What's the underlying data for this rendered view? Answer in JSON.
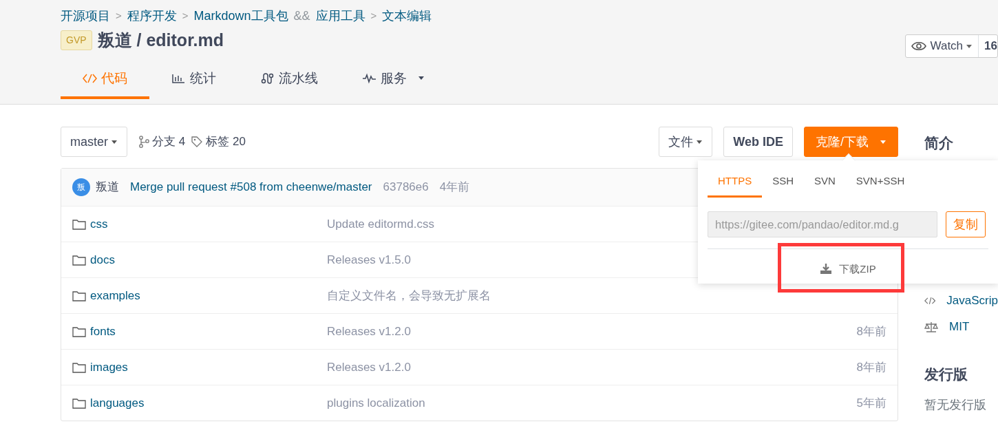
{
  "breadcrumb": [
    {
      "kind": "link",
      "text": "开源项目"
    },
    {
      "kind": "sep",
      "text": ">"
    },
    {
      "kind": "link",
      "text": "程序开发"
    },
    {
      "kind": "sep",
      "text": ">"
    },
    {
      "kind": "link",
      "text": "Markdown工具包"
    },
    {
      "kind": "joiner",
      "text": "&&"
    },
    {
      "kind": "link",
      "text": "应用工具"
    },
    {
      "kind": "sep",
      "text": ">"
    },
    {
      "kind": "link",
      "text": "文本编辑"
    }
  ],
  "repo": {
    "badge": "GVP",
    "title": "叛道 / editor.md"
  },
  "watch": {
    "label": "Watch",
    "count": "16"
  },
  "tabs": [
    {
      "label": "代码",
      "selected": true,
      "dropdown": false
    },
    {
      "label": "统计",
      "selected": false,
      "dropdown": false
    },
    {
      "label": "流水线",
      "selected": false,
      "dropdown": false
    },
    {
      "label": "服务",
      "selected": false,
      "dropdown": true
    }
  ],
  "toolbar": {
    "branch": "master",
    "branches": "分支 4",
    "tags": "标签 20",
    "file_menu": "文件",
    "web_ide": "Web IDE",
    "clone": "克隆/下载"
  },
  "commit": {
    "avatar": "叛",
    "author": "叛道",
    "message": "Merge pull request #508 from cheenwe/master",
    "hash": "63786e6",
    "time": "4年前"
  },
  "files": [
    {
      "name": "css",
      "message": "Update editormd.css"
    },
    {
      "name": "docs",
      "message": "Releases v1.5.0"
    },
    {
      "name": "examples",
      "message": "自定义文件名，会导致无扩展名"
    },
    {
      "name": "fonts",
      "message": "Releases v1.2.0",
      "time": "8年前"
    },
    {
      "name": "images",
      "message": "Releases v1.2.0",
      "time": "8年前"
    },
    {
      "name": "languages",
      "message": "plugins localization",
      "time": "5年前"
    }
  ],
  "clone_popup": {
    "tabs": [
      {
        "label": "HTTPS",
        "selected": true
      },
      {
        "label": "SSH",
        "selected": false
      },
      {
        "label": "SVN",
        "selected": false
      },
      {
        "label": "SVN+SSH",
        "selected": false
      }
    ],
    "url": "https://gitee.com/pandao/editor.md.g",
    "copy": "复制",
    "download": "下载ZIP",
    "highlighted": true
  },
  "sidebar": {
    "intro_title": "简介",
    "items": [
      {
        "kind": "language",
        "text": "JavaScrip"
      },
      {
        "kind": "license",
        "text": "MIT"
      }
    ],
    "releases_title": "发行版",
    "releases_empty": "暂无发行版"
  }
}
